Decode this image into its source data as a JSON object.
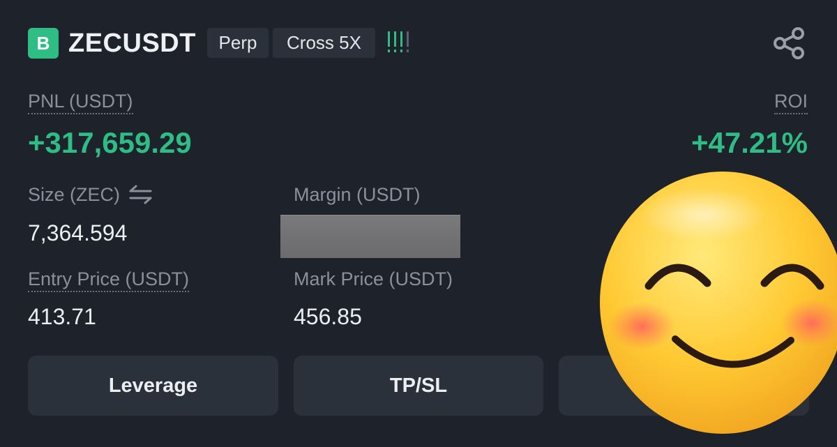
{
  "header": {
    "logo_letter": "B",
    "symbol": "ZECUSDT",
    "tags": [
      "Perp",
      "Cross 5X"
    ],
    "risk_icon": "risk-bars-icon",
    "share_icon": "share-icon"
  },
  "pnl": {
    "label": "PNL (USDT)",
    "value": "+317,659.29"
  },
  "roi": {
    "label": "ROI",
    "value": "+47.21%"
  },
  "size": {
    "label": "Size (ZEC)",
    "value": "7,364.594",
    "swap_icon": "swap-arrows-icon"
  },
  "margin": {
    "label": "Margin (USDT)"
  },
  "entry_price": {
    "label": "Entry Price (USDT)",
    "value": "413.71"
  },
  "mark_price": {
    "label": "Mark Price (USDT)",
    "value": "456.85"
  },
  "buttons": {
    "leverage": "Leverage",
    "tpsl": "TP/SL"
  },
  "overlay": {
    "icon": "smiling-face-emoji-icon"
  },
  "colors": {
    "background": "#1e222b",
    "positive": "#2ebd85",
    "tag_bg": "#2b313b",
    "label": "#8b919c"
  }
}
